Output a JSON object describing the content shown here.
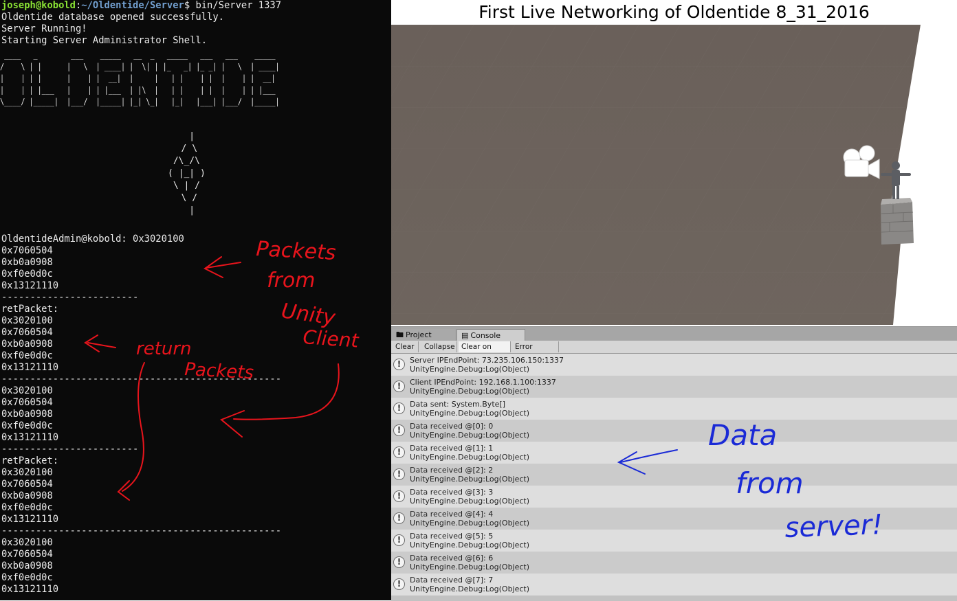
{
  "terminal": {
    "prompt_user": "joseph@kobold",
    "prompt_path": "~/Oldentide/Server",
    "prompt_cmd": "$ bin/Server 1337",
    "lines": [
      "Oldentide database opened successfully.",
      "Server Running!",
      "Starting Server Administrator Shell."
    ],
    "banner_art": " ____   _        ___    _____   __  _   _____   ___   ___    _____\n/    \\ | |      |   \\  | ____| |  \\| | |_   _| |_ _| |   \\  | ____|\n|    | | |      |    | |  __|  |     |   | |    | |  |    | |  __|\n|    | | |___   |    | | |___  | |\\  |   | |    | |  |    | | |___\n\\____/ |_____|  |___/  |_____| |_| \\_|   |_|   |___| |___/  |_____|",
    "emblem_art": "  |\n / \\\n/\\_/\\\n( |_| )\n\\ | /\n \\ /\n  |",
    "output": [
      "OldentideAdmin@kobold: 0x3020100",
      "0x7060504",
      "0xb0a0908",
      "0xf0e0d0c",
      "0x13121110",
      "------------------------",
      "retPacket:",
      "0x3020100",
      "0x7060504",
      "0xb0a0908",
      "0xf0e0d0c",
      "0x13121110",
      "-------------------------------------------------",
      "0x3020100",
      "0x7060504",
      "0xb0a0908",
      "0xf0e0d0c",
      "0x13121110",
      "------------------------",
      "retPacket:",
      "0x3020100",
      "0x7060504",
      "0xb0a0908",
      "0xf0e0d0c",
      "0x13121110",
      "-------------------------------------------------",
      "0x3020100",
      "0x7060504",
      "0xb0a0908",
      "0xf0e0d0c",
      "0x13121110"
    ]
  },
  "title": "First Live Networking of Oldentide 8_31_2016",
  "scene": {
    "camera_icon": "video-camera-gizmo-icon",
    "character": "humanoid-character-model",
    "pedestal": "stone-block-pedestal"
  },
  "console": {
    "tabs": [
      {
        "label": "Project",
        "icon": "folder-icon"
      },
      {
        "label": "Console",
        "icon": "console-icon"
      }
    ],
    "toolbar": [
      "Clear",
      "Collapse",
      "Clear on Play",
      "Error Pause"
    ],
    "active_toolbar": [
      "Clear on Play"
    ],
    "entries": [
      {
        "line1": "Server IPEndPoint: 73.235.106.150:1337",
        "line2": "UnityEngine.Debug:Log(Object)"
      },
      {
        "line1": "Client IPEndPoint: 192.168.1.100:1337",
        "line2": "UnityEngine.Debug:Log(Object)"
      },
      {
        "line1": "Data sent: System.Byte[]",
        "line2": "UnityEngine.Debug:Log(Object)"
      },
      {
        "line1": "Data received @[0]: 0",
        "line2": "UnityEngine.Debug:Log(Object)"
      },
      {
        "line1": "Data received @[1]: 1",
        "line2": "UnityEngine.Debug:Log(Object)"
      },
      {
        "line1": "Data received @[2]: 2",
        "line2": "UnityEngine.Debug:Log(Object)"
      },
      {
        "line1": "Data received @[3]: 3",
        "line2": "UnityEngine.Debug:Log(Object)"
      },
      {
        "line1": "Data received @[4]: 4",
        "line2": "UnityEngine.Debug:Log(Object)"
      },
      {
        "line1": "Data received @[5]: 5",
        "line2": "UnityEngine.Debug:Log(Object)"
      },
      {
        "line1": "Data received @[6]: 6",
        "line2": "UnityEngine.Debug:Log(Object)"
      },
      {
        "line1": "Data received @[7]: 7",
        "line2": "UnityEngine.Debug:Log(Object)"
      }
    ],
    "entry_icon": "warning-info-icon"
  },
  "annotations": {
    "red": {
      "packets_from_unity_client": [
        "Packets",
        "from",
        "Unity",
        "Client"
      ],
      "return_packets": [
        "return",
        "Packets"
      ],
      "color": "#e8141c"
    },
    "blue": {
      "data_from_server": [
        "Data",
        "from",
        "server!"
      ],
      "color": "#1a2ad6"
    }
  },
  "colors": {
    "terminal_bg": "#0a0a0a",
    "prompt_user": "#8ae234",
    "prompt_path": "#729fcf",
    "scene_floor": "#6b615a",
    "console_bg": "#c2c2c2"
  }
}
